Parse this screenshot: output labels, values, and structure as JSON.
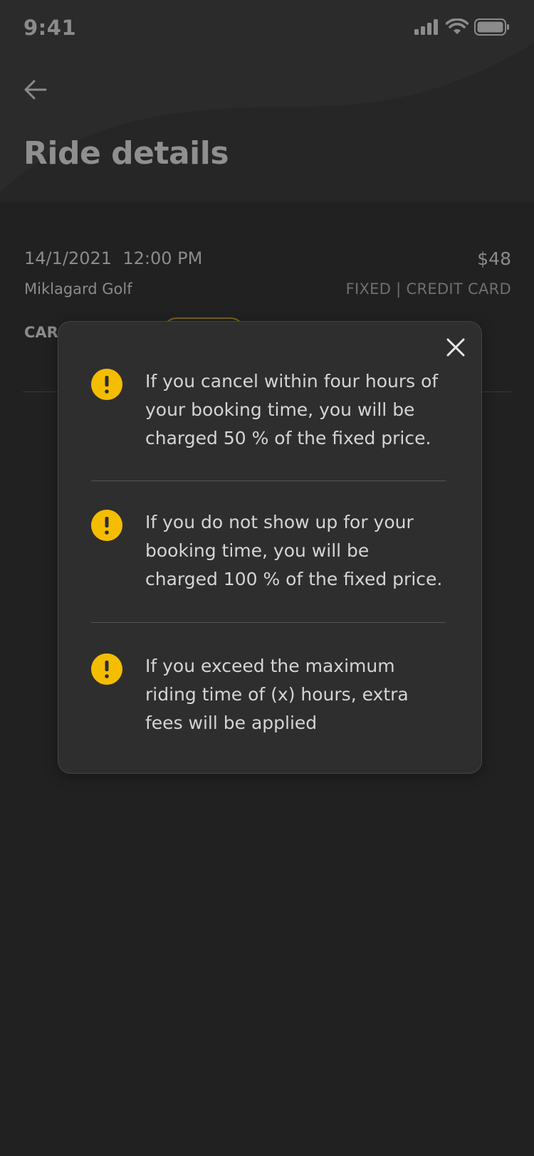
{
  "status_bar": {
    "time": "9:41"
  },
  "header": {
    "title": "Ride details"
  },
  "ride": {
    "date": "14/1/2021",
    "time": "12:00 PM",
    "price": "$48",
    "location": "Miklagard Golf",
    "payment": "FIXED | CREDIT CARD",
    "car_label": "CAR"
  },
  "modal": {
    "notices": [
      {
        "text": "If you cancel within four hours of your booking time, you will be charged 50 % of the fixed price."
      },
      {
        "text": "If you do not show up for your booking time, you will be charged 100 % of the fixed price."
      },
      {
        "text": "If you exceed the maximum riding time of (x) hours, extra fees will be applied"
      }
    ]
  },
  "colors": {
    "background": "#212121",
    "modal": "#2e2e2e",
    "warning": "#f5bd00",
    "text_muted": "#8b8b8b"
  },
  "icons": {
    "back": "arrow-left-icon",
    "close": "close-icon",
    "warning": "warning-icon",
    "signal": "cellular-signal-icon",
    "wifi": "wifi-icon",
    "battery": "battery-icon"
  }
}
